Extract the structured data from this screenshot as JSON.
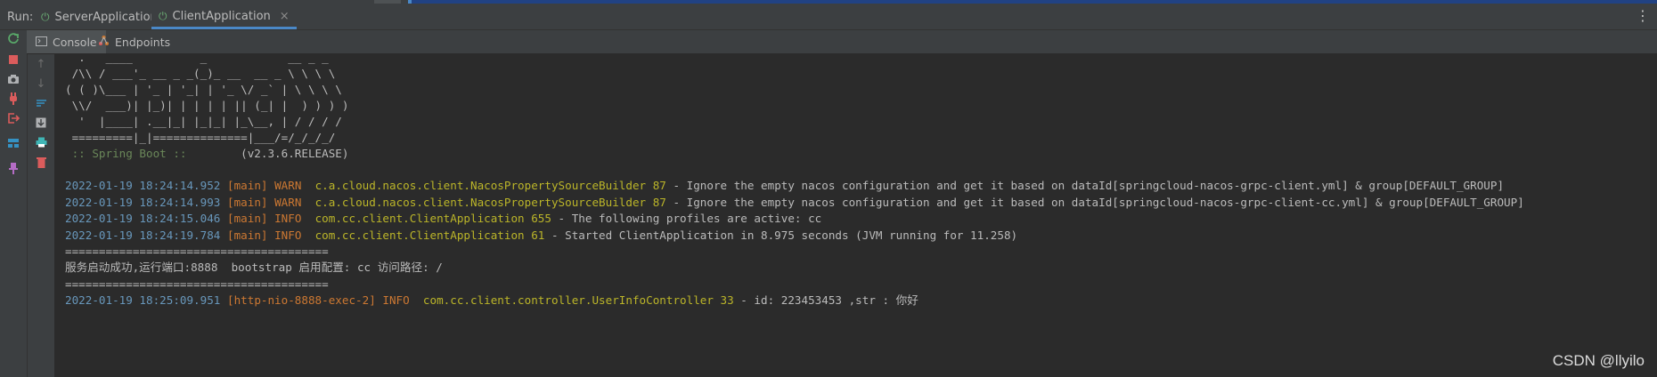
{
  "run_bar": {
    "label": "Run:",
    "tabs": [
      {
        "label": "ServerApplication",
        "close": "×"
      },
      {
        "label": "ClientApplication",
        "close": "×"
      }
    ],
    "more": "⋮"
  },
  "secondary_tabs": [
    {
      "label": "Console"
    },
    {
      "label": "Endpoints"
    }
  ],
  "banner": [
    "  .   ____          _            __ _ _",
    " /\\\\ / ___'_ __ _ _(_)_ __  __ _ \\ \\ \\ \\",
    "( ( )\\___ | '_ | '_| | '_ \\/ _` | \\ \\ \\ \\",
    " \\\\/  ___)| |_)| | | | | || (_| |  ) ) ) )",
    "  '  |____| .__|_| |_|_| |_\\__, | / / / /",
    " =========|_|==============|___/=/_/_/_/"
  ],
  "spring_line": {
    "label": " :: Spring Boot ::",
    "version": "        (v2.3.6.RELEASE)"
  },
  "log_lines": [
    {
      "ts": "2022-01-19 18:24:14.952",
      "thread": "[main]",
      "level": "WARN ",
      "logger": "c.a.cloud.nacos.client.NacosPropertySourceBuilder 87",
      "msg": " - Ignore the empty nacos configuration and get it based on dataId[springcloud-nacos-grpc-client.yml] & group[DEFAULT_GROUP]"
    },
    {
      "ts": "2022-01-19 18:24:14.993",
      "thread": "[main]",
      "level": "WARN ",
      "logger": "c.a.cloud.nacos.client.NacosPropertySourceBuilder 87",
      "msg": " - Ignore the empty nacos configuration and get it based on dataId[springcloud-nacos-grpc-client-cc.yml] & group[DEFAULT_GROUP]"
    },
    {
      "ts": "2022-01-19 18:24:15.046",
      "thread": "[main]",
      "level": "INFO ",
      "logger": "com.cc.client.ClientApplication 655",
      "msg": " - The following profiles are active: cc"
    },
    {
      "ts": "2022-01-19 18:24:19.784",
      "thread": "[main]",
      "level": "INFO ",
      "logger": "com.cc.client.ClientApplication 61",
      "msg": " - Started ClientApplication in 8.975 seconds (JVM running for 11.258)"
    }
  ],
  "plain_lines": [
    "=======================================",
    "服务启动成功,运行端口:8888  bootstrap 启用配置: cc 访问路径: /",
    "======================================="
  ],
  "last_log": {
    "ts": "2022-01-19 18:25:09.951",
    "thread": "[http-nio-8888-exec-2]",
    "level": "INFO ",
    "logger": "com.cc.client.controller.UserInfoController 33",
    "msg": " - id: 223453453 ,str : 你好"
  },
  "watermark": "CSDN @llyilo",
  "icons": {
    "left": [
      "rerun-icon",
      "stop-icon",
      "camera-icon",
      "plug-icon",
      "exit-icon",
      "layout-icon",
      "pin-icon"
    ],
    "gutter": [
      "scroll-up-icon",
      "scroll-down-icon",
      "soft-wrap-icon",
      "scroll-to-end-icon",
      "print-icon",
      "clear-icon"
    ]
  },
  "colors": {
    "accent": "#4a88c7",
    "timestamp": "#6897bb",
    "level": "#cc7832",
    "logger": "#bbb529",
    "banner_green": "#6a8759"
  }
}
